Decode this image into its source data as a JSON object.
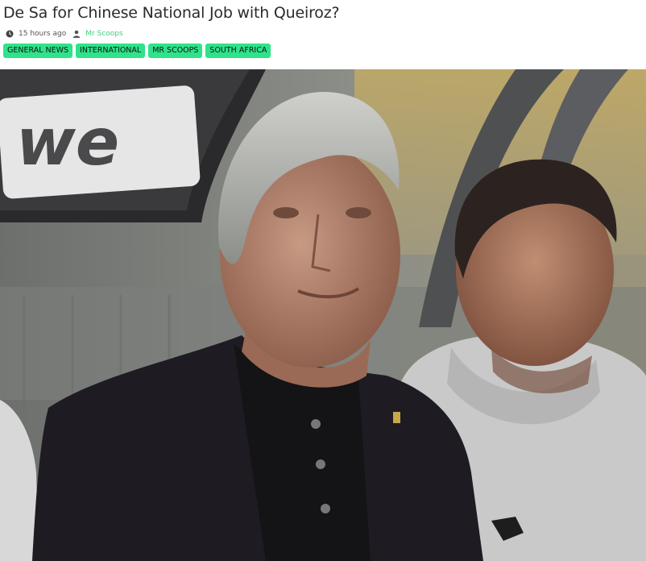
{
  "article": {
    "title": "De Sa for Chinese National Job with Queiroz?",
    "time_ago": "15 hours ago",
    "author": "Mr Scoops",
    "clock_icon": "clock-icon",
    "user_icon": "user-icon",
    "tags": [
      "GENERAL NEWS",
      "INTERNATIONAL",
      "MR SCOOPS",
      "SOUTH AFRICA"
    ],
    "tag_color": "#2ee38a",
    "author_color": "#3ed07a"
  },
  "image": {
    "sign_text": "we"
  }
}
